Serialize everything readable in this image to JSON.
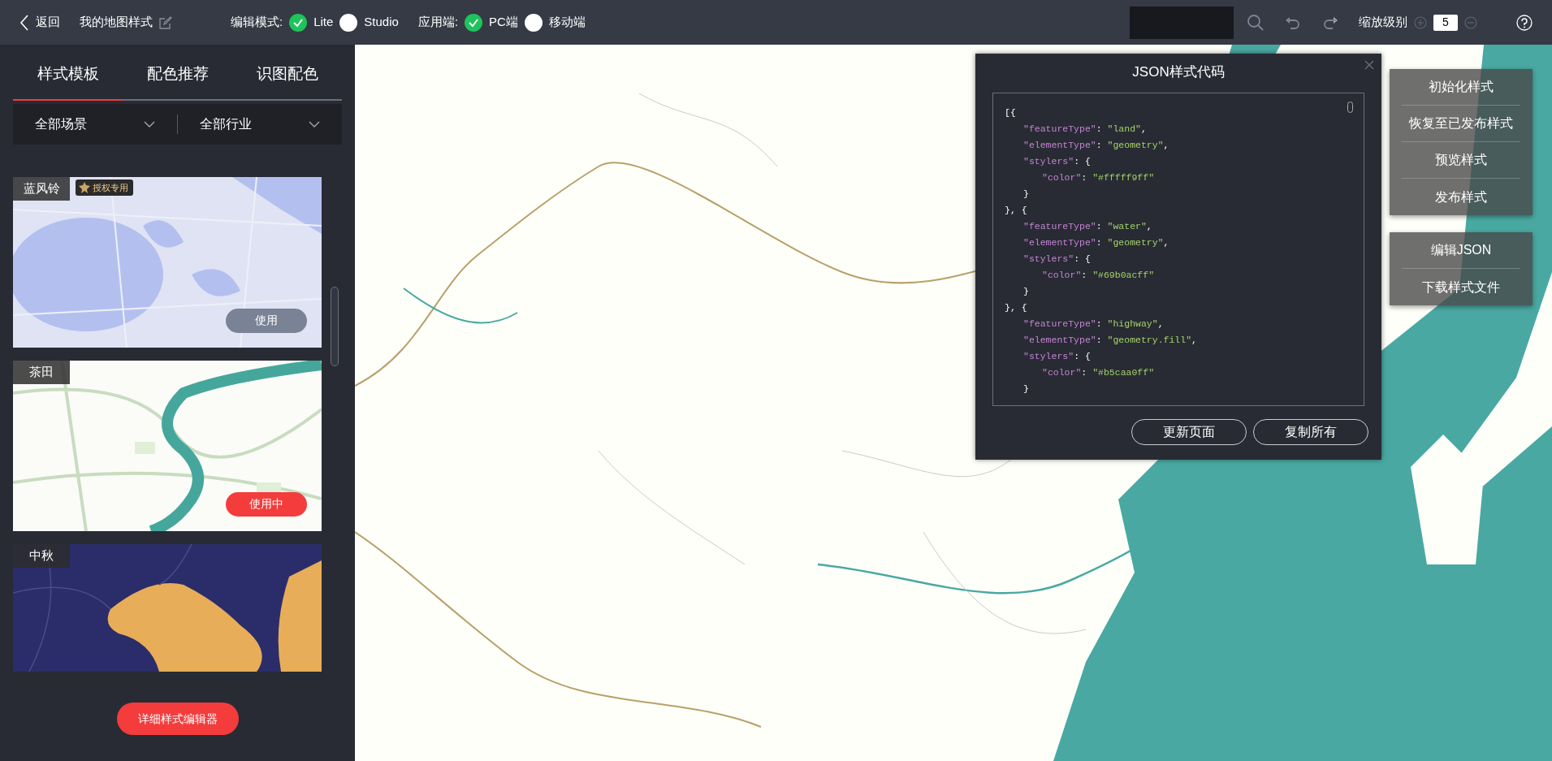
{
  "header": {
    "back": "返回",
    "title": "我的地图样式",
    "edit_mode": {
      "label": "编辑模式:",
      "options": [
        {
          "label": "Lite",
          "selected": true
        },
        {
          "label": "Studio",
          "selected": false
        }
      ]
    },
    "platform": {
      "label": "应用端:",
      "options": [
        {
          "label": "PC端",
          "selected": true
        },
        {
          "label": "移动端",
          "selected": false
        }
      ]
    },
    "zoom": {
      "label": "缩放级别",
      "value": "5"
    }
  },
  "sidebar": {
    "tabs": [
      {
        "label": "样式模板",
        "selected": true
      },
      {
        "label": "配色推荐",
        "selected": false
      },
      {
        "label": "识图配色",
        "selected": false
      }
    ],
    "filters": [
      "全部场景",
      "全部行业"
    ],
    "templates": [
      {
        "name": "蓝风铃",
        "badge": "授权专用",
        "button": "使用",
        "active": false
      },
      {
        "name": "茶田",
        "button": "使用中",
        "active": true
      },
      {
        "name": "中秋"
      }
    ],
    "editor_button": "详细样式编辑器"
  },
  "json_dialog": {
    "title": "JSON样式代码",
    "lines": [
      {
        "kind": "outer",
        "segments": [
          {
            "kind": "punct",
            "text": "[{"
          }
        ]
      },
      {
        "kind": "field",
        "segments": [
          {
            "kind": "key",
            "text": "\"featureType\""
          },
          {
            "kind": "punct",
            "text": ": "
          },
          {
            "kind": "string",
            "text": "\"land\""
          },
          {
            "kind": "punct",
            "text": ","
          }
        ]
      },
      {
        "kind": "field",
        "segments": [
          {
            "kind": "key",
            "text": "\"elementType\""
          },
          {
            "kind": "punct",
            "text": ": "
          },
          {
            "kind": "string",
            "text": "\"geometry\""
          },
          {
            "kind": "punct",
            "text": ","
          }
        ]
      },
      {
        "kind": "field",
        "segments": [
          {
            "kind": "key",
            "text": "\"stylers\""
          },
          {
            "kind": "punct",
            "text": ": {"
          }
        ]
      },
      {
        "kind": "nested",
        "segments": [
          {
            "kind": "key",
            "text": "\"color\""
          },
          {
            "kind": "punct",
            "text": ": "
          },
          {
            "kind": "string",
            "text": "\"#fffff9ff\""
          }
        ]
      },
      {
        "kind": "field",
        "segments": [
          {
            "kind": "punct",
            "text": "}"
          }
        ]
      },
      {
        "kind": "outer",
        "segments": [
          {
            "kind": "punct",
            "text": "}, {"
          }
        ]
      },
      {
        "kind": "field",
        "segments": [
          {
            "kind": "key",
            "text": "\"featureType\""
          },
          {
            "kind": "punct",
            "text": ": "
          },
          {
            "kind": "string",
            "text": "\"water\""
          },
          {
            "kind": "punct",
            "text": ","
          }
        ]
      },
      {
        "kind": "field",
        "segments": [
          {
            "kind": "key",
            "text": "\"elementType\""
          },
          {
            "kind": "punct",
            "text": ": "
          },
          {
            "kind": "string",
            "text": "\"geometry\""
          },
          {
            "kind": "punct",
            "text": ","
          }
        ]
      },
      {
        "kind": "field",
        "segments": [
          {
            "kind": "key",
            "text": "\"stylers\""
          },
          {
            "kind": "punct",
            "text": ": {"
          }
        ]
      },
      {
        "kind": "nested",
        "segments": [
          {
            "kind": "key",
            "text": "\"color\""
          },
          {
            "kind": "punct",
            "text": ": "
          },
          {
            "kind": "string",
            "text": "\"#69b0acff\""
          }
        ]
      },
      {
        "kind": "field",
        "segments": [
          {
            "kind": "punct",
            "text": "}"
          }
        ]
      },
      {
        "kind": "outer",
        "segments": [
          {
            "kind": "punct",
            "text": "}, {"
          }
        ]
      },
      {
        "kind": "field",
        "segments": [
          {
            "kind": "key",
            "text": "\"featureType\""
          },
          {
            "kind": "punct",
            "text": ": "
          },
          {
            "kind": "string",
            "text": "\"highway\""
          },
          {
            "kind": "punct",
            "text": ","
          }
        ]
      },
      {
        "kind": "field",
        "segments": [
          {
            "kind": "key",
            "text": "\"elementType\""
          },
          {
            "kind": "punct",
            "text": ": "
          },
          {
            "kind": "string",
            "text": "\"geometry.fill\""
          },
          {
            "kind": "punct",
            "text": ","
          }
        ]
      },
      {
        "kind": "field",
        "segments": [
          {
            "kind": "key",
            "text": "\"stylers\""
          },
          {
            "kind": "punct",
            "text": ": {"
          }
        ]
      },
      {
        "kind": "nested",
        "segments": [
          {
            "kind": "key",
            "text": "\"color\""
          },
          {
            "kind": "punct",
            "text": ": "
          },
          {
            "kind": "string",
            "text": "\"#b5caa0ff\""
          }
        ]
      },
      {
        "kind": "field",
        "segments": [
          {
            "kind": "punct",
            "text": "}"
          }
        ]
      }
    ],
    "buttons": [
      "更新页面",
      "复制所有"
    ]
  },
  "action_groups": [
    [
      "初始化样式",
      "恢复至已发布样式",
      "预览样式",
      "发布样式"
    ],
    [
      "编辑JSON",
      "下载样式文件"
    ]
  ]
}
